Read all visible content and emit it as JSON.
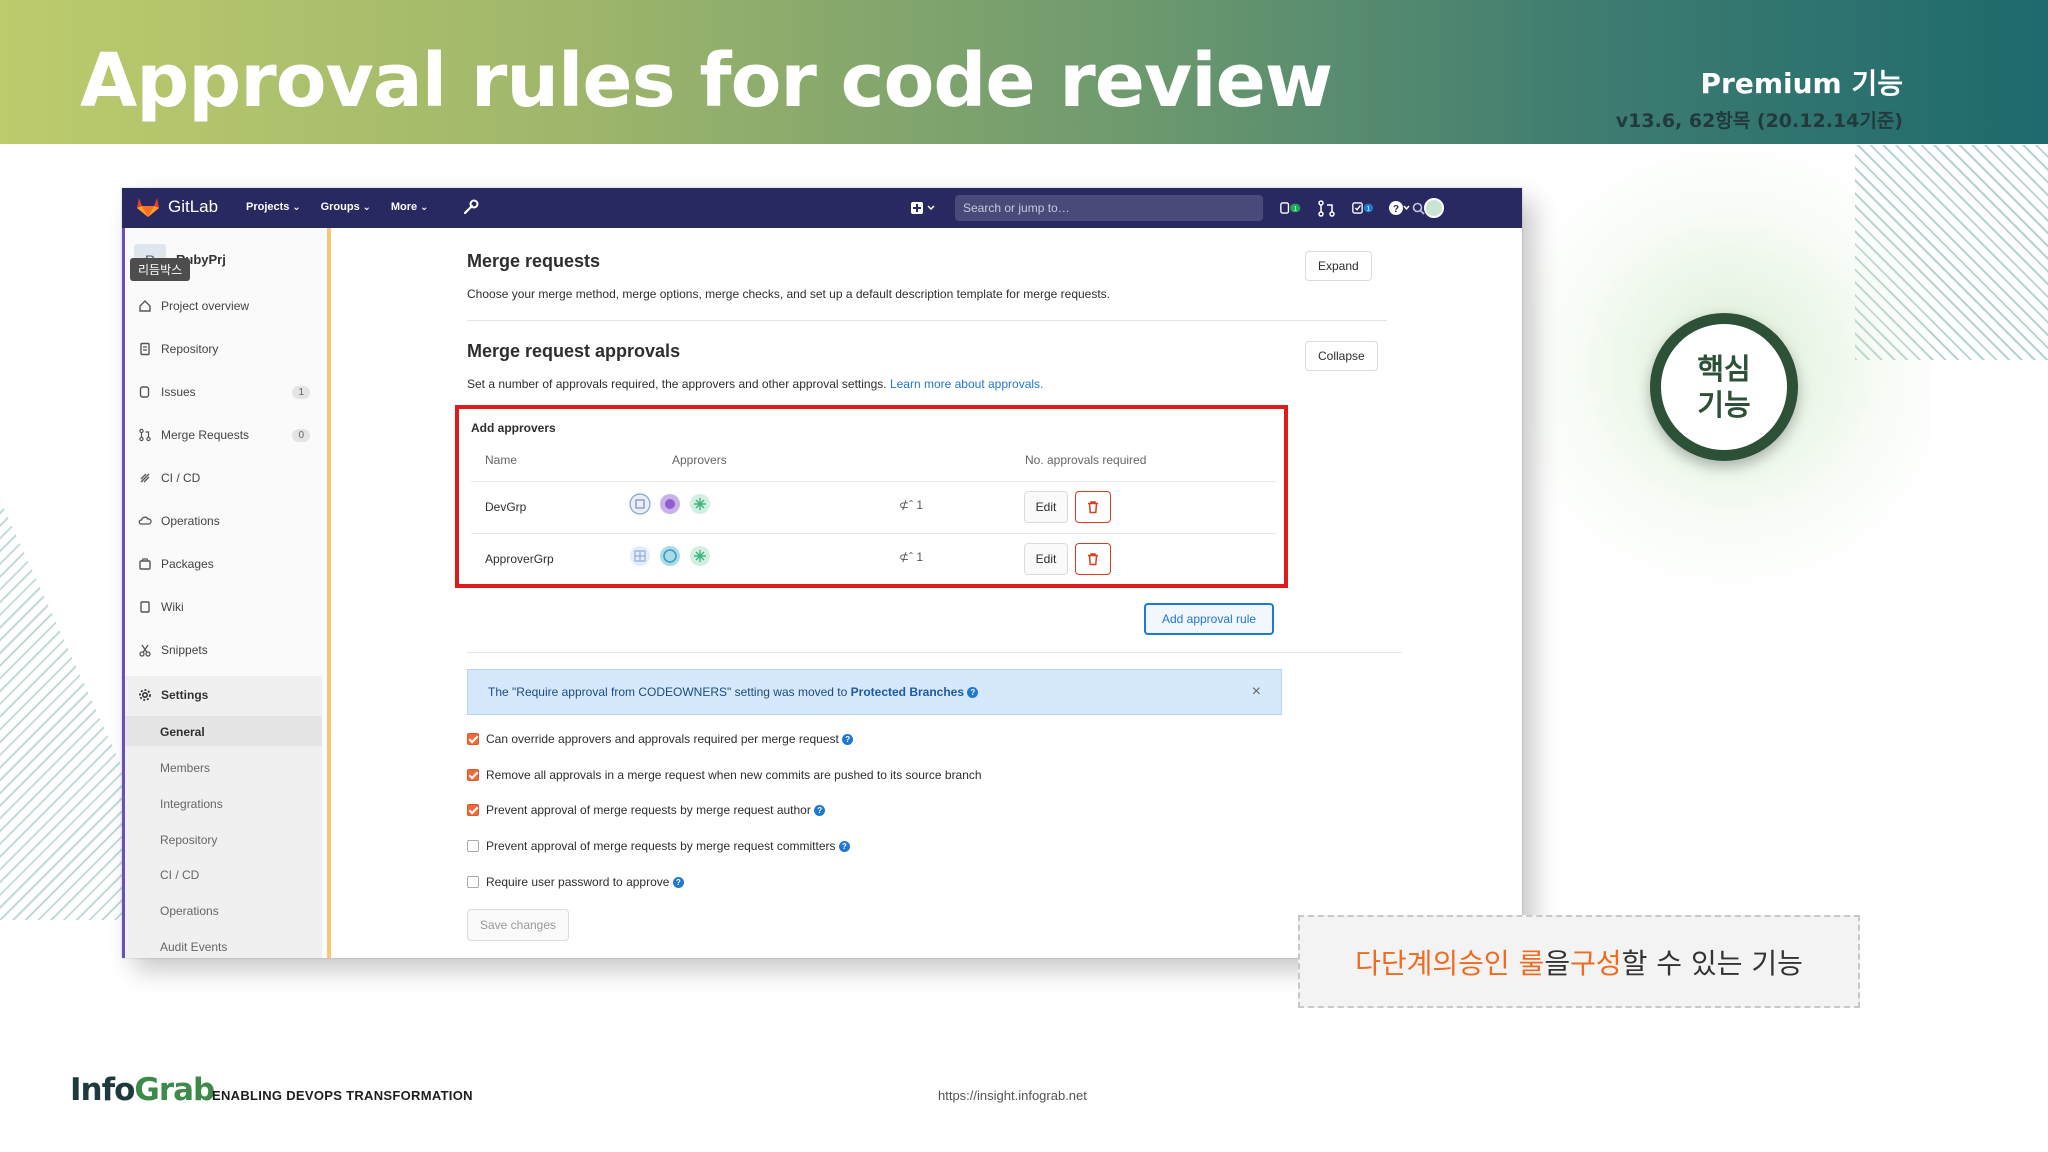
{
  "slide": {
    "title": "Approval rules for code review",
    "tier_name": "Premium 기능",
    "tier_version": "v13.6, 62항목 (20.12.14기준)",
    "badge_text": "핵심\n기능",
    "callout": {
      "part1": "다단계의 ",
      "part2": "승인 룰",
      "part3": "을 ",
      "part4": "구성",
      "part5": " 할 수 있는 기능"
    },
    "footer": {
      "logo_info": "Info",
      "logo_grab": "Grab",
      "tagline": "ENABLING DEVOPS TRANSFORMATION",
      "url": "https://insight.infograb.net"
    },
    "colors": {
      "accent_orange": "#ef6b1f",
      "badge_green": "#2d5137",
      "highlight_red": "#e11a1a"
    }
  },
  "gitlab": {
    "brand": "GitLab",
    "nav": [
      "Projects",
      "Groups",
      "More"
    ],
    "search_placeholder": "Search or jump to…",
    "badges": {
      "issues": "1",
      "todos": "1"
    },
    "project": {
      "initial": "R",
      "name": "RubyPrj",
      "tooltip": "리듬박스"
    },
    "sidebar": {
      "items": [
        {
          "label": "Project overview",
          "icon": "home-icon"
        },
        {
          "label": "Repository",
          "icon": "doc-icon"
        },
        {
          "label": "Issues",
          "icon": "issues-icon",
          "count": "1"
        },
        {
          "label": "Merge Requests",
          "icon": "merge-request-icon",
          "count": "0"
        },
        {
          "label": "CI / CD",
          "icon": "rocket-icon"
        },
        {
          "label": "Operations",
          "icon": "cloud-icon"
        },
        {
          "label": "Packages",
          "icon": "package-icon"
        },
        {
          "label": "Wiki",
          "icon": "book-icon"
        },
        {
          "label": "Snippets",
          "icon": "scissors-icon"
        },
        {
          "label": "Settings",
          "icon": "gear-icon"
        }
      ],
      "settings_sub": [
        "General",
        "Members",
        "Integrations",
        "Repository",
        "CI / CD",
        "Operations",
        "Audit Events"
      ]
    },
    "merge_requests": {
      "title": "Merge requests",
      "desc": "Choose your merge method, merge options, merge checks, and set up a default description template for merge requests.",
      "button": "Expand"
    },
    "approvals": {
      "title": "Merge request approvals",
      "desc": "Set a number of approvals required, the approvers and other approval settings.",
      "link": "Learn more about approvals.",
      "button": "Collapse",
      "table_title": "Add approvers",
      "col_name": "Name",
      "col_approvers": "Approvers",
      "col_required": "No. approvals required",
      "rows": [
        {
          "name": "DevGrp",
          "required": "1",
          "edit": "Edit"
        },
        {
          "name": "ApproverGrp",
          "required": "1",
          "edit": "Edit"
        }
      ],
      "add_rule": "Add approval rule",
      "alert_prefix": "The \"Require approval from CODEOWNERS\" setting was moved to ",
      "alert_link": "Protected Branches",
      "options": [
        {
          "label": "Can override approvers and approvals required per merge request",
          "checked": true,
          "help": true
        },
        {
          "label": "Remove all approvals in a merge request when new commits are pushed to its source branch",
          "checked": true,
          "help": false
        },
        {
          "label": "Prevent approval of merge requests by merge request author",
          "checked": true,
          "help": true
        },
        {
          "label": "Prevent approval of merge requests by merge request committers",
          "checked": false,
          "help": true
        },
        {
          "label": "Require user password to approve",
          "checked": false,
          "help": true
        }
      ],
      "save": "Save changes"
    }
  }
}
